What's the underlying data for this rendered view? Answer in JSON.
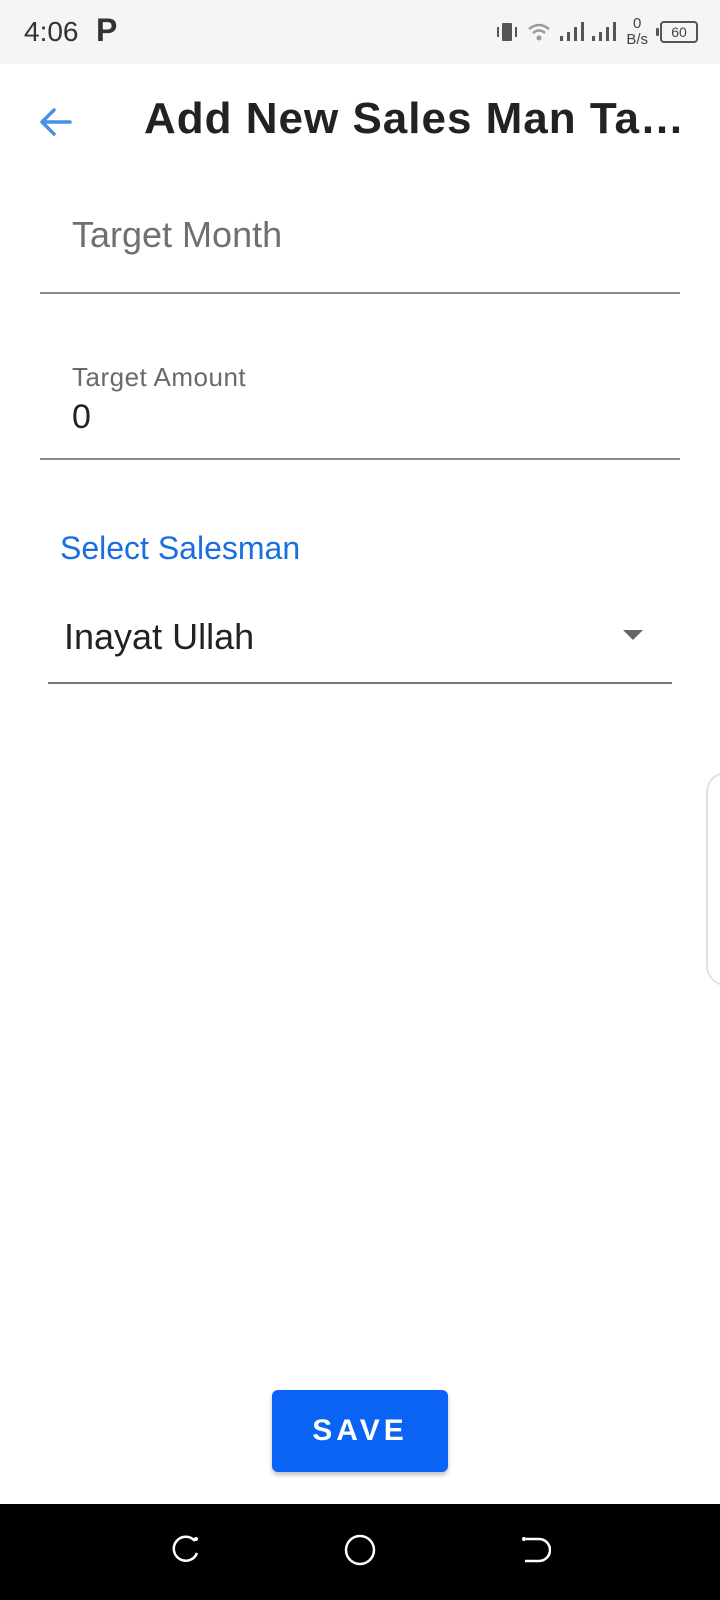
{
  "status_bar": {
    "time": "4:06",
    "notification_icon": "P",
    "net_speed_value": "0",
    "net_speed_unit": "B/s",
    "battery": "60"
  },
  "app_bar": {
    "title": "Add New Sales Man Target"
  },
  "form": {
    "target_month": {
      "placeholder": "Target Month",
      "value": ""
    },
    "target_amount": {
      "label": "Target Amount",
      "value": "0"
    },
    "salesman": {
      "label": "Select Salesman",
      "selected": "Inayat Ullah"
    }
  },
  "actions": {
    "save_label": "SAVE"
  },
  "colors": {
    "accent": "#1a6fe0",
    "button": "#0a63f5",
    "back_arrow": "#4a90e2"
  }
}
